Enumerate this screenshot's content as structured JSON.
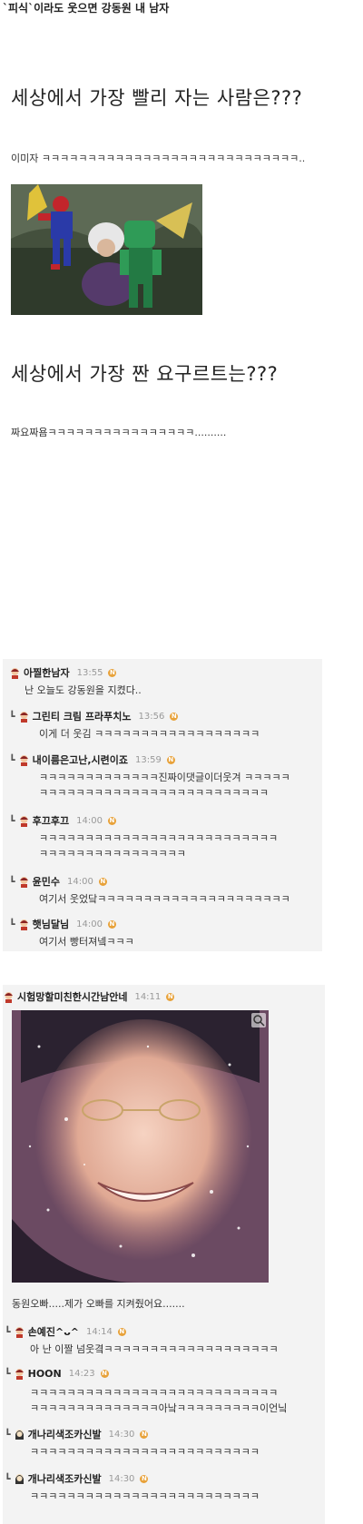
{
  "post": {
    "title": "`피식`이라도 웃으면 강동원 내 남자",
    "q1": "세상에서 가장 빨리 자는 사람은???",
    "a1": "이미자 ㅋㅋㅋㅋㅋㅋㅋㅋㅋㅋㅋㅋㅋㅋㅋㅋㅋㅋㅋㅋㅋㅋㅋㅋㅋㅋㅋㅋ..",
    "q2": "세상에서 가장 짠 요구르트는???",
    "a2": "짜요짜욤ㅋㅋㅋㅋㅋㅋㅋㅋㅋㅋㅋㅋㅋㅋㅋㅋ.........."
  },
  "comments1": [
    {
      "nick": "아찔한남자",
      "time": "13:55",
      "lines": [
        "난 오늘도 강동원을 지켰다.."
      ],
      "reply": false
    },
    {
      "nick": "그린티 크림 프라푸치노",
      "time": "13:56",
      "lines": [
        "이게 더 웃김 ㅋㅋㅋㅋㅋㅋㅋㅋㅋㅋㅋㅋㅋㅋㅋㅋㅋㅋ"
      ],
      "reply": true
    },
    {
      "nick": "내이름은고난,시련이죠",
      "time": "13:59",
      "lines": [
        "ㅋㅋㅋㅋㅋㅋㅋㅋㅋㅋㅋㅋㅋ진짜이댓글이더웃겨 ㅋㅋㅋㅋㅋ",
        "ㅋㅋㅋㅋㅋㅋㅋㅋㅋㅋㅋㅋㅋㅋㅋㅋㅋㅋㅋㅋㅋㅋㅋㅋㅋ"
      ],
      "reply": true
    },
    {
      "nick": "후끄후끄",
      "time": "14:00",
      "lines": [
        "ㅋㅋㅋㅋㅋㅋㅋㅋㅋㅋㅋㅋㅋㅋㅋㅋㅋㅋㅋㅋㅋㅋㅋㅋㅋㅋ",
        "ㅋㅋㅋㅋㅋㅋㅋㅋㅋㅋㅋㅋㅋㅋㅋㅋ"
      ],
      "reply": true
    },
    {
      "nick": "윤민수",
      "time": "14:00",
      "lines": [
        "여기서 웃었닼ㅋㅋㅋㅋㅋㅋㅋㅋㅋㅋㅋㅋㅋㅋㅋㅋㅋㅋㅋㅋㅋ"
      ],
      "reply": true
    },
    {
      "nick": "햇님달님",
      "time": "14:00",
      "lines": [
        "여기서 빵터져넼ㅋㅋㅋ"
      ],
      "reply": true
    }
  ],
  "comments2_header": {
    "nick": "시험망할미친한시간남안네",
    "time": "14:11"
  },
  "photo_caption": "동원오빠.....제가 오빠를 지켜줬어요.......",
  "comments2": [
    {
      "nick": "손예진^ᴗ^",
      "time": "14:14",
      "lines": [
        "아 난 이짤 넘웃곀ㅋㅋㅋㅋㅋㅋㅋㅋㅋㅋㅋㅋㅋㅋㅋㅋㅋㅋㅋ"
      ]
    },
    {
      "nick": "HOON",
      "time": "14:23",
      "lines": [
        "ㅋㅋㅋㅋㅋㅋㅋㅋㅋㅋㅋㅋㅋㅋㅋㅋㅋㅋㅋㅋㅋㅋㅋㅋㅋㅋㅋ",
        "ㅋㅋㅋㅋㅋㅋㅋㅋㅋㅋㅋㅋㅋㅋ아낰ㅋㅋㅋㅋㅋㅋㅋㅋㅋ이언닠"
      ]
    },
    {
      "nick": "개나리색조카신발",
      "time": "14:30",
      "lines": [
        "ㅋㅋㅋㅋㅋㅋㅋㅋㅋㅋㅋㅋㅋㅋㅋㅋㅋㅋㅋㅋㅋㅋㅋㅋㅋ"
      ]
    },
    {
      "nick": "개나리색조카신발",
      "time": "14:30",
      "lines": [
        "ㅋㅋㅋㅋㅋㅋㅋㅋㅋㅋㅋㅋㅋㅋㅋㅋㅋㅋㅋㅋㅋㅋㅋㅋㅋ"
      ]
    }
  ],
  "badge_label": "N"
}
